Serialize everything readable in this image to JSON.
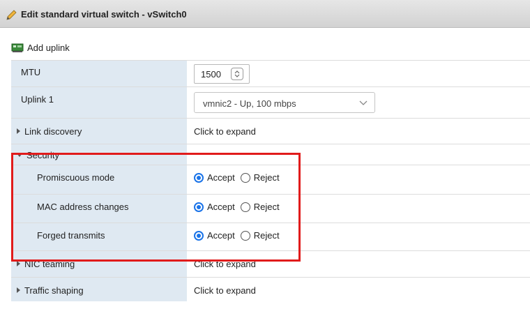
{
  "window": {
    "title": "Edit standard virtual switch - vSwitch0",
    "title_icon": "pencil-icon"
  },
  "toolbar": {
    "add_uplink_label": "Add uplink",
    "add_uplink_icon": "network-adapter-icon"
  },
  "settings": {
    "mtu": {
      "label": "MTU",
      "value": "1500"
    },
    "uplink1": {
      "label": "Uplink 1",
      "value": "vmnic2 - Up, 100 mbps"
    },
    "link_discovery": {
      "label": "Link discovery",
      "value": "Click to expand",
      "expanded": false
    },
    "security": {
      "label": "Security",
      "expanded": true,
      "highlighted": true,
      "highlight_color": "#e11b1b",
      "items": [
        {
          "label": "Promiscuous mode",
          "options": [
            "Accept",
            "Reject"
          ],
          "selected": "Accept"
        },
        {
          "label": "MAC address changes",
          "options": [
            "Accept",
            "Reject"
          ],
          "selected": "Accept"
        },
        {
          "label": "Forged transmits",
          "options": [
            "Accept",
            "Reject"
          ],
          "selected": "Accept"
        }
      ]
    },
    "nic_teaming": {
      "label": "NIC teaming",
      "value": "Click to expand",
      "expanded": false
    },
    "traffic_shaping": {
      "label": "Traffic shaping",
      "value": "Click to expand",
      "expanded": false
    }
  },
  "colors": {
    "label_bg": "#dfe9f2",
    "radio_selected": "#1a73e8"
  }
}
